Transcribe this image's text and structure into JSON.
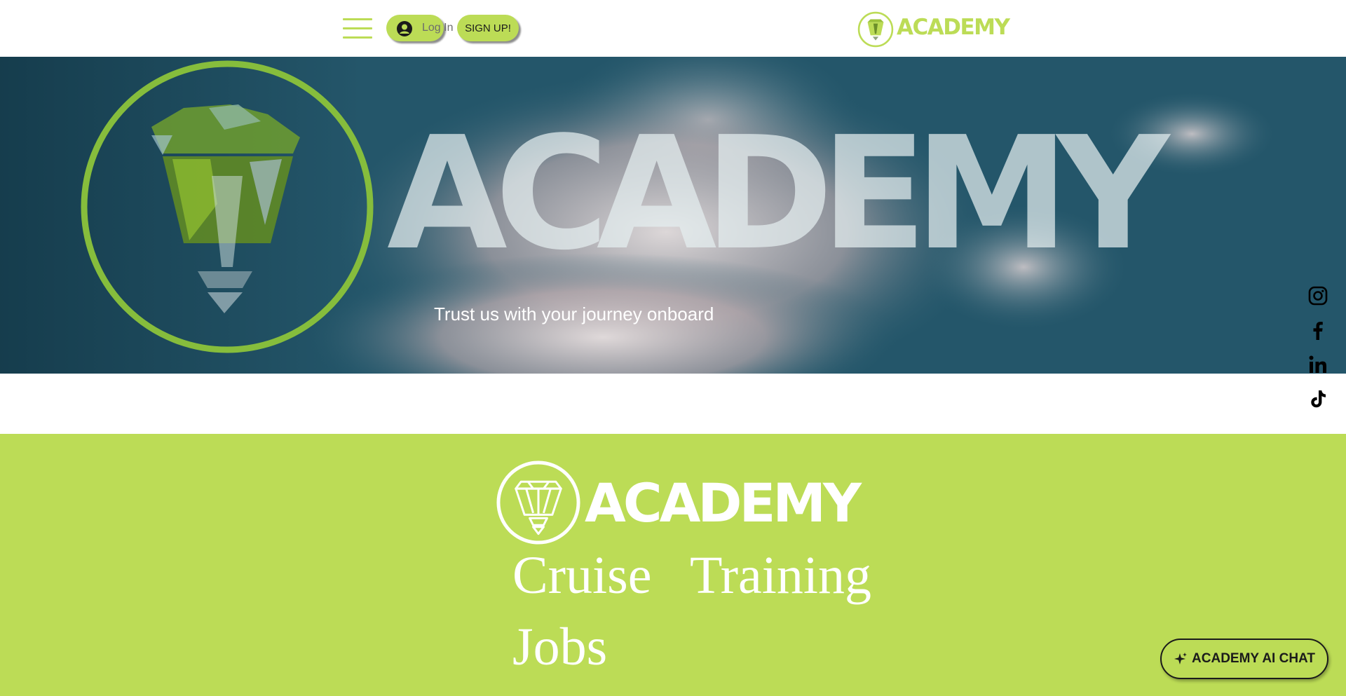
{
  "header": {
    "menu_icon": "hamburger-icon",
    "login_label": "Log In",
    "login_icon": "user-avatar-icon",
    "signup_label": "SIGN UP!",
    "logo_text": "ACADEMY",
    "logo_icon": "academy-crest-logo"
  },
  "hero": {
    "wordmark": "ACADEMY",
    "tagline": "Trust us with your journey onboard",
    "background": "ocean-wake-video"
  },
  "social": [
    {
      "name": "Instagram",
      "icon": "instagram-icon"
    },
    {
      "name": "Facebook",
      "icon": "facebook-icon"
    },
    {
      "name": "LinkedIn",
      "icon": "linkedin-icon"
    },
    {
      "name": "TikTok",
      "icon": "tiktok-icon"
    }
  ],
  "footer": {
    "logo_text": "ACADEMY",
    "links": [
      "Cruise",
      "Training",
      "Jobs"
    ]
  },
  "chat": {
    "label": "ACADEMY AI CHAT",
    "icon": "sparkle-icon"
  },
  "colors": {
    "accent": "#bcdc56",
    "text_dark": "#1b1b1b",
    "white": "#ffffff"
  }
}
